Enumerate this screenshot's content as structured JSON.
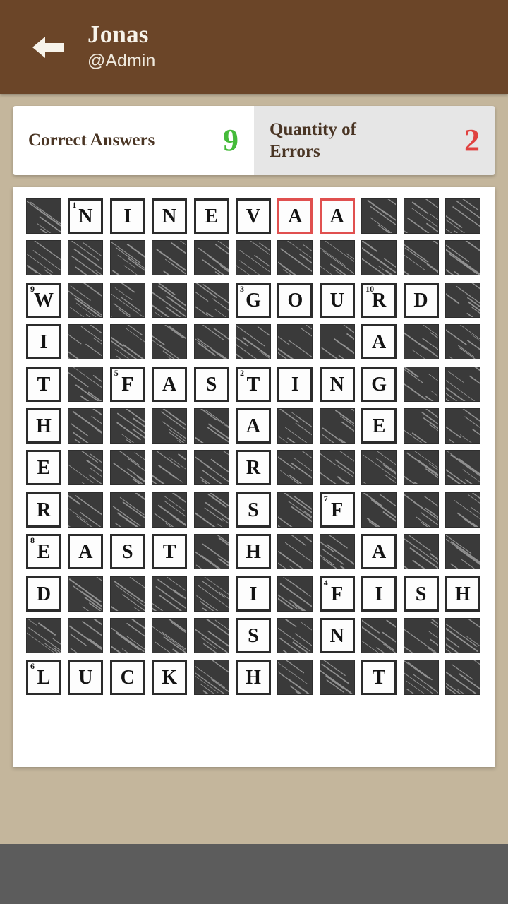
{
  "header": {
    "back_icon": "arrow-left-icon",
    "title": "Jonas",
    "subtitle": "@Admin"
  },
  "stats": {
    "correct": {
      "label": "Correct Answers",
      "value": "9",
      "color": "#45bb3a"
    },
    "errors": {
      "label": "Quantity of Errors",
      "value": "2",
      "color": "#e0413f"
    }
  },
  "puzzle": {
    "rows": 12,
    "cols": 11,
    "error_border_color": "#e0504f",
    "block_color": "#3a3a3a",
    "grid": [
      [
        {
          "t": "block"
        },
        {
          "t": "letter",
          "ch": "N",
          "n": "1"
        },
        {
          "t": "letter",
          "ch": "I"
        },
        {
          "t": "letter",
          "ch": "N"
        },
        {
          "t": "letter",
          "ch": "E"
        },
        {
          "t": "letter",
          "ch": "V"
        },
        {
          "t": "letter",
          "ch": "A",
          "err": true
        },
        {
          "t": "letter",
          "ch": "A",
          "err": true
        },
        {
          "t": "block"
        },
        {
          "t": "block"
        },
        {
          "t": "block"
        }
      ],
      [
        {
          "t": "block"
        },
        {
          "t": "block"
        },
        {
          "t": "block"
        },
        {
          "t": "block"
        },
        {
          "t": "block"
        },
        {
          "t": "block"
        },
        {
          "t": "block"
        },
        {
          "t": "block"
        },
        {
          "t": "block"
        },
        {
          "t": "block"
        },
        {
          "t": "block"
        }
      ],
      [
        {
          "t": "letter",
          "ch": "W",
          "n": "9"
        },
        {
          "t": "block"
        },
        {
          "t": "block"
        },
        {
          "t": "block"
        },
        {
          "t": "block"
        },
        {
          "t": "letter",
          "ch": "G",
          "n": "3"
        },
        {
          "t": "letter",
          "ch": "O"
        },
        {
          "t": "letter",
          "ch": "U"
        },
        {
          "t": "letter",
          "ch": "R",
          "n": "10"
        },
        {
          "t": "letter",
          "ch": "D"
        },
        {
          "t": "block"
        }
      ],
      [
        {
          "t": "letter",
          "ch": "I"
        },
        {
          "t": "block"
        },
        {
          "t": "block"
        },
        {
          "t": "block"
        },
        {
          "t": "block"
        },
        {
          "t": "block"
        },
        {
          "t": "block"
        },
        {
          "t": "block"
        },
        {
          "t": "letter",
          "ch": "A"
        },
        {
          "t": "block"
        },
        {
          "t": "block"
        }
      ],
      [
        {
          "t": "letter",
          "ch": "T"
        },
        {
          "t": "block"
        },
        {
          "t": "letter",
          "ch": "F",
          "n": "5"
        },
        {
          "t": "letter",
          "ch": "A"
        },
        {
          "t": "letter",
          "ch": "S"
        },
        {
          "t": "letter",
          "ch": "T",
          "n": "2"
        },
        {
          "t": "letter",
          "ch": "I"
        },
        {
          "t": "letter",
          "ch": "N"
        },
        {
          "t": "letter",
          "ch": "G"
        },
        {
          "t": "block"
        },
        {
          "t": "block"
        }
      ],
      [
        {
          "t": "letter",
          "ch": "H"
        },
        {
          "t": "block"
        },
        {
          "t": "block"
        },
        {
          "t": "block"
        },
        {
          "t": "block"
        },
        {
          "t": "letter",
          "ch": "A"
        },
        {
          "t": "block"
        },
        {
          "t": "block"
        },
        {
          "t": "letter",
          "ch": "E"
        },
        {
          "t": "block"
        },
        {
          "t": "block"
        }
      ],
      [
        {
          "t": "letter",
          "ch": "E"
        },
        {
          "t": "block"
        },
        {
          "t": "block"
        },
        {
          "t": "block"
        },
        {
          "t": "block"
        },
        {
          "t": "letter",
          "ch": "R"
        },
        {
          "t": "block"
        },
        {
          "t": "block"
        },
        {
          "t": "block"
        },
        {
          "t": "block"
        },
        {
          "t": "block"
        }
      ],
      [
        {
          "t": "letter",
          "ch": "R"
        },
        {
          "t": "block"
        },
        {
          "t": "block"
        },
        {
          "t": "block"
        },
        {
          "t": "block"
        },
        {
          "t": "letter",
          "ch": "S"
        },
        {
          "t": "block"
        },
        {
          "t": "letter",
          "ch": "F",
          "n": "7"
        },
        {
          "t": "block"
        },
        {
          "t": "block"
        },
        {
          "t": "block"
        }
      ],
      [
        {
          "t": "letter",
          "ch": "E",
          "n": "8"
        },
        {
          "t": "letter",
          "ch": "A"
        },
        {
          "t": "letter",
          "ch": "S"
        },
        {
          "t": "letter",
          "ch": "T"
        },
        {
          "t": "block"
        },
        {
          "t": "letter",
          "ch": "H"
        },
        {
          "t": "block"
        },
        {
          "t": "block"
        },
        {
          "t": "letter",
          "ch": "A"
        },
        {
          "t": "block"
        },
        {
          "t": "block"
        }
      ],
      [
        {
          "t": "letter",
          "ch": "D"
        },
        {
          "t": "block"
        },
        {
          "t": "block"
        },
        {
          "t": "block"
        },
        {
          "t": "block"
        },
        {
          "t": "letter",
          "ch": "I"
        },
        {
          "t": "block"
        },
        {
          "t": "letter",
          "ch": "F",
          "n": "4"
        },
        {
          "t": "letter",
          "ch": "I"
        },
        {
          "t": "letter",
          "ch": "S"
        },
        {
          "t": "letter",
          "ch": "H"
        }
      ],
      [
        {
          "t": "block"
        },
        {
          "t": "block"
        },
        {
          "t": "block"
        },
        {
          "t": "block"
        },
        {
          "t": "block"
        },
        {
          "t": "letter",
          "ch": "S"
        },
        {
          "t": "block"
        },
        {
          "t": "letter",
          "ch": "N"
        },
        {
          "t": "block"
        },
        {
          "t": "block"
        },
        {
          "t": "block"
        }
      ],
      [
        {
          "t": "letter",
          "ch": "L",
          "n": "6"
        },
        {
          "t": "letter",
          "ch": "U"
        },
        {
          "t": "letter",
          "ch": "C"
        },
        {
          "t": "letter",
          "ch": "K"
        },
        {
          "t": "block"
        },
        {
          "t": "letter",
          "ch": "H"
        },
        {
          "t": "block"
        },
        {
          "t": "block"
        },
        {
          "t": "letter",
          "ch": "T"
        },
        {
          "t": "block"
        },
        {
          "t": "block"
        }
      ]
    ]
  }
}
